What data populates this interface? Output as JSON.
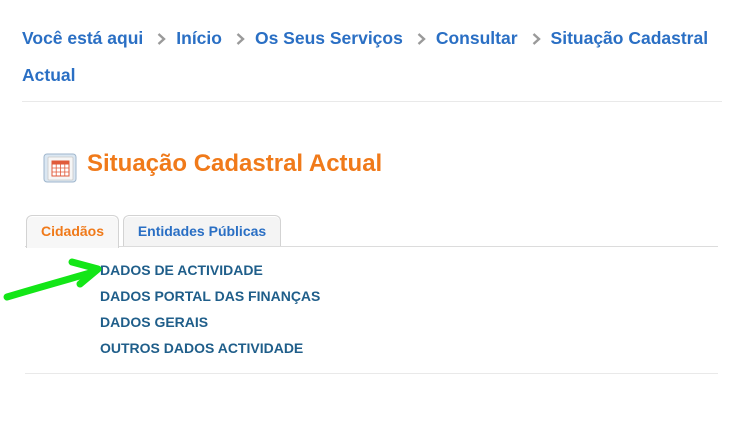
{
  "breadcrumb": {
    "prefix": "Você está aqui",
    "items": [
      {
        "label": "Início"
      },
      {
        "label": "Os Seus Serviços"
      },
      {
        "label": "Consultar"
      },
      {
        "label": "Situação Cadastral Actual"
      }
    ]
  },
  "page": {
    "title": "Situação Cadastral Actual",
    "icon": "calendar-table-icon"
  },
  "tabs": [
    {
      "label": "Cidadãos",
      "active": true
    },
    {
      "label": "Entidades Públicas",
      "active": false
    }
  ],
  "links": [
    {
      "label": "DADOS DE ACTIVIDADE"
    },
    {
      "label": "DADOS PORTAL DAS FINANÇAS"
    },
    {
      "label": "DADOS GERAIS"
    },
    {
      "label": "OUTROS DADOS ACTIVIDADE"
    }
  ],
  "annotation": {
    "icon": "green-arrow-annotation",
    "color": "#13e617"
  },
  "colors": {
    "link_blue": "#2a6fc4",
    "accent_orange": "#f07a1a",
    "list_link": "#1f5e8a"
  }
}
